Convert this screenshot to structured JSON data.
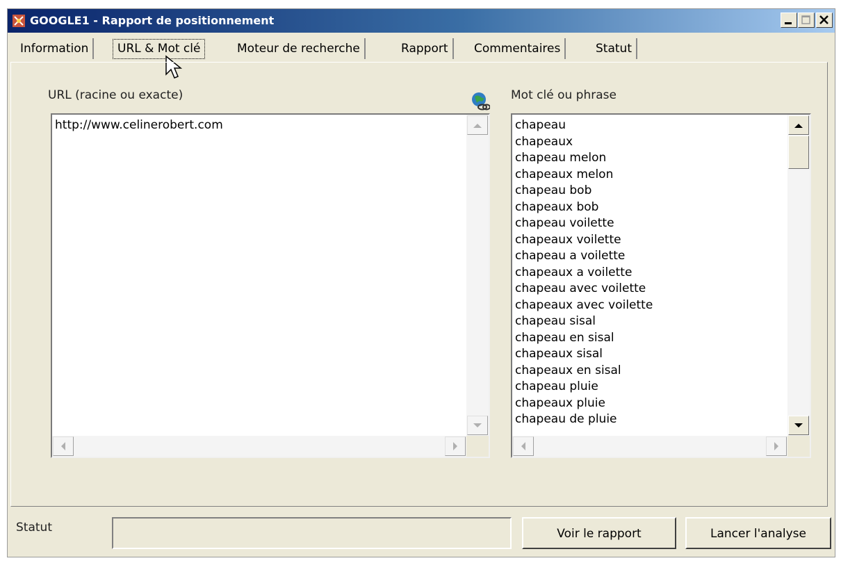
{
  "window": {
    "title": "GOOGLE1 - Rapport de positionnement"
  },
  "tabs": [
    {
      "label": "Information"
    },
    {
      "label": "URL & Mot clé"
    },
    {
      "label": "Moteur de recherche"
    },
    {
      "label": "Rapport"
    },
    {
      "label": "Commentaires"
    },
    {
      "label": "Statut"
    }
  ],
  "url_section": {
    "label": "URL (racine ou exacte)",
    "value": "http://www.celinerobert.com"
  },
  "keyword_section": {
    "label": "Mot clé ou phrase",
    "items": [
      "chapeau",
      "chapeaux",
      "chapeau melon",
      "chapeaux melon",
      "chapeau bob",
      "chapeaux bob",
      "chapeau voilette",
      "chapeaux voilette",
      "chapeau a voilette",
      "chapeaux a voilette",
      "chapeau avec voilette",
      "chapeaux avec voilette",
      "chapeau sisal",
      "chapeau en sisal",
      "chapeaux sisal",
      "chapeaux en sisal",
      "chapeau pluie",
      "chapeaux pluie",
      "chapeau de pluie"
    ]
  },
  "status": {
    "label": "Statut",
    "value": ""
  },
  "buttons": {
    "view_report": "Voir le rapport",
    "run_analysis": "Lancer l'analyse"
  },
  "icons": [
    "app-icon",
    "globe-link-icon",
    "minimize-icon",
    "maximize-icon",
    "close-icon",
    "mouse-cursor-icon"
  ],
  "colors": {
    "titlebar_start": "#0a246a",
    "titlebar_end": "#a6caf0",
    "window_bg": "#ece9d8"
  }
}
